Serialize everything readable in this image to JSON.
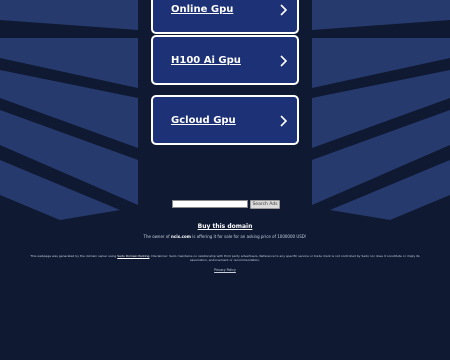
{
  "colors": {
    "background": "#0f1932",
    "stripe": "#263a6e",
    "button_fill": "#1d3176",
    "button_border": "#ffffff"
  },
  "ads": [
    {
      "label": "Online Gpu",
      "icon": "chevron-right-icon"
    },
    {
      "label": "H100 Ai Gpu",
      "icon": "chevron-right-icon"
    },
    {
      "label": "Gcloud Gpu",
      "icon": "chevron-right-icon"
    }
  ],
  "search": {
    "placeholder": "",
    "button_label": "Search Ads"
  },
  "buy": {
    "label": "Buy this domain"
  },
  "owner": {
    "prefix": "The owner of ",
    "domain": "ncix.com",
    "suffix": " is offering it for sale for an asking price of 1000000 USD!"
  },
  "disclaimer": {
    "part1": "This webpage was generated by the domain owner using ",
    "link": "Sedo Domain Parking",
    "part2": ". Disclaimer: Sedo maintains no relationship with third party advertisers. Reference to any specific service or trade mark is not controlled by Sedo nor does it constitute or imply its association, endorsement or recommendation."
  },
  "privacy": {
    "label": "Privacy Policy"
  }
}
